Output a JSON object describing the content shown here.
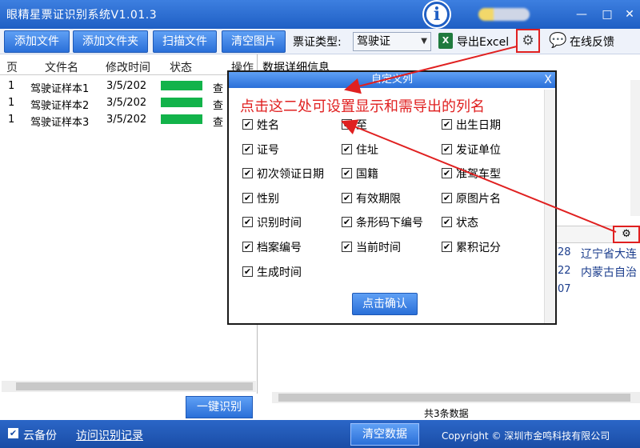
{
  "app": {
    "title": "眼精星票证识别系统V1.01.3",
    "logo_letter": "i",
    "minimize": "—",
    "maximize": "□",
    "close": "✕"
  },
  "toolbar": {
    "add_file": "添加文件",
    "add_folder": "添加文件夹",
    "scan_file": "扫描文件",
    "clear_images": "清空图片",
    "type_label": "票证类型:",
    "type_value": "驾驶证",
    "excel_icon_letter": "X",
    "export_excel": "导出Excel",
    "settings_icon": "gear-icon",
    "feedback": "在线反馈"
  },
  "file_list": {
    "headers": [
      "页",
      "文件名",
      "修改时间",
      "状态",
      "操作"
    ],
    "rows": [
      {
        "page": "1",
        "name": "驾驶证样本1",
        "time": "3/5/202",
        "action": "查"
      },
      {
        "page": "1",
        "name": "驾驶证样本2",
        "time": "3/5/202",
        "action": "查"
      },
      {
        "page": "1",
        "name": "驾驶证样本3",
        "time": "3/5/202",
        "action": "查"
      }
    ],
    "status_color": "#12b34a"
  },
  "detail": {
    "title": "数据详细信息",
    "right_cells": [
      {
        "num": "28",
        "text": "辽宁省大连"
      },
      {
        "num": "22",
        "text": "内蒙古自治"
      },
      {
        "num": "07",
        "text": ""
      }
    ],
    "total": "共3条数据"
  },
  "one_key": "一键识别",
  "dialog": {
    "title": "自定义列",
    "close": "X",
    "annotation": "点击这二处可设置显示和需导出的列名",
    "confirm": "点击确认",
    "columns": [
      [
        "姓名",
        "至",
        "出生日期"
      ],
      [
        "证号",
        "住址",
        "发证单位"
      ],
      [
        "初次领证日期",
        "国籍",
        "准驾车型"
      ],
      [
        "性别",
        "有效期限",
        "原图片名"
      ],
      [
        "识别时间",
        "条形码下编号",
        "状态"
      ],
      [
        "档案编号",
        "当前时间",
        "累积记分"
      ],
      [
        "生成时间"
      ]
    ],
    "check_mark": "✔"
  },
  "bottom": {
    "cloud_backup": "云备份",
    "history": "访问识别记录",
    "clear_data": "清空数据",
    "copyright": "Copyright © 深圳市金鸣科技有限公司"
  },
  "colors": {
    "accent": "#2a6fd8",
    "annotation_red": "#e02020",
    "status_green": "#12b34a"
  }
}
